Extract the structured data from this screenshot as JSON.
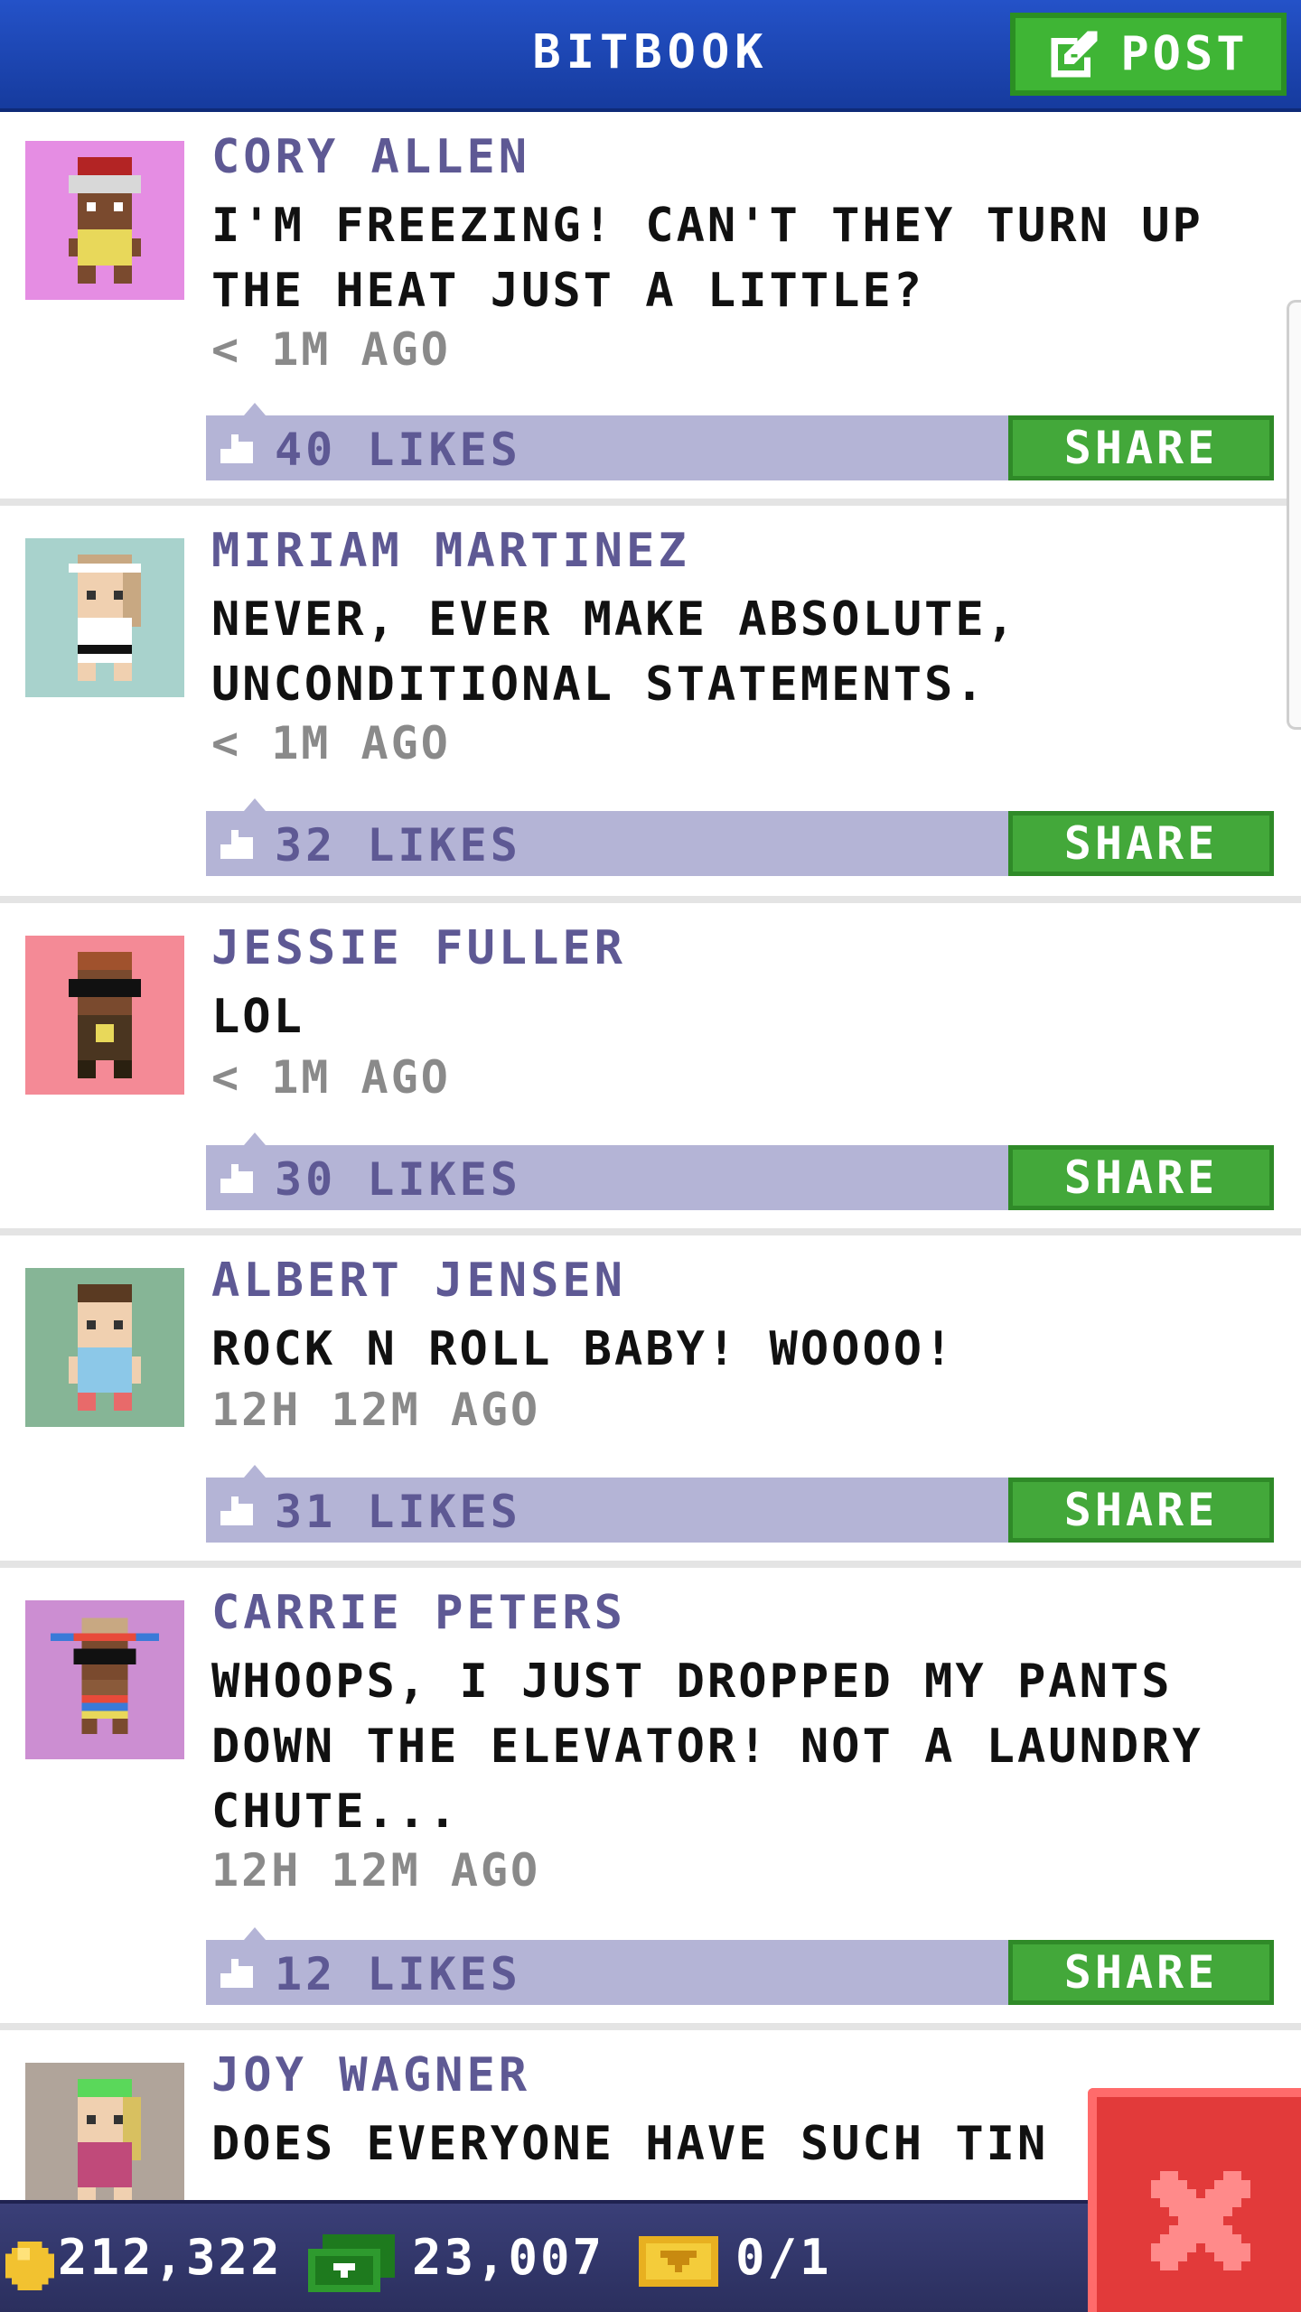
{
  "header": {
    "title": "BITBOOK",
    "post_label": "POST"
  },
  "posts": [
    {
      "author": "CORY ALLEN",
      "message": "I'M FREEZING! CAN'T THEY TURN UP THE HEAT JUST A LITTLE?",
      "time": "< 1M AGO",
      "likes": "40 LIKES",
      "share": "SHARE",
      "avatar_bg": "#e58de3"
    },
    {
      "author": "MIRIAM MARTINEZ",
      "message": "NEVER, EVER MAKE ABSOLUTE, UNCONDITIONAL STATEMENTS.",
      "time": "< 1M AGO",
      "likes": "32 LIKES",
      "share": "SHARE",
      "avatar_bg": "#a8d2cc"
    },
    {
      "author": "JESSIE FULLER",
      "message": "LOL",
      "time": "< 1M AGO",
      "likes": "30 LIKES",
      "share": "SHARE",
      "avatar_bg": "#f48a96"
    },
    {
      "author": "ALBERT JENSEN",
      "message": "ROCK N ROLL BABY! WOOOO!",
      "time": "12H 12M AGO",
      "likes": "31 LIKES",
      "share": "SHARE",
      "avatar_bg": "#86b596"
    },
    {
      "author": "CARRIE PETERS",
      "message": "WHOOPS, I JUST DROPPED MY PANTS DOWN THE ELEVATOR! NOT A LAUNDRY CHUTE...",
      "time": "12H 12M AGO",
      "likes": "12 LIKES",
      "share": "SHARE",
      "avatar_bg": "#cc8ed2"
    },
    {
      "author": "JOY WAGNER",
      "message": "DOES EVERYONE HAVE SUCH TIN",
      "avatar_bg": "#b0a49a"
    }
  ],
  "status": {
    "coins": "212,322",
    "bux": "23,007",
    "tickets": "0/1"
  },
  "colors": {
    "header": "#1e48b8",
    "accent_green": "#43a83a",
    "likes_bar": "#b4b4d6",
    "author_text": "#5e5994",
    "close_red": "#e23a3a"
  },
  "icons": [
    "edit-icon",
    "like-icon",
    "coin-icon",
    "cash-icon",
    "ticket-icon",
    "close-icon"
  ]
}
